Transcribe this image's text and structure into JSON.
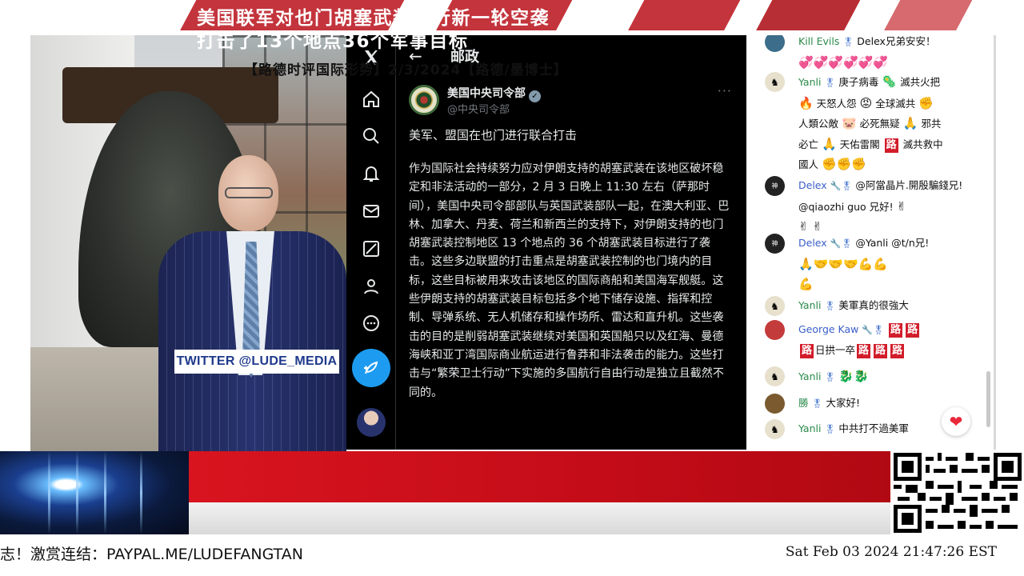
{
  "video": {
    "watermark": "TWITTER  @LUDE_MEDIA"
  },
  "x_post": {
    "header_title": "邮政",
    "author_name": "美国中央司令部",
    "author_handle": "@中央司令部",
    "headline": "美军、盟国在也门进行联合打击",
    "body": "作为国际社会持续努力应对伊朗支持的胡塞武装在该地区破坏稳定和非法活动的一部分，2 月 3 日晚上 11:30 左右（萨那时间），美国中央司令部部队与英国武装部队一起，在澳大利亚、巴林、加拿大、丹麦、荷兰和新西兰的支持下，对伊朗支持的也门胡塞武装控制地区 13 个地点的 36 个胡塞武装目标进行了袭击。这些多边联盟的打击重点是胡塞武装控制的也门境内的目标，这些目标被用来攻击该地区的国际商船和美国海军舰艇。这些伊朗支持的胡塞武装目标包括多个地下储存设施、指挥和控制、导弹系统、无人机储存和操作场所、雷达和直升机。这些袭击的目的是削弱胡塞武装继续对美国和英国船只以及红海、曼德海峡和亚丁湾国际商业航运进行鲁莽和非法袭击的能力。这些打击与“繁荣卫士行动”下实施的多国航行自由行动是独立且截然不同的。",
    "nav_icons": [
      "x-logo-icon",
      "home-icon",
      "search-icon",
      "bell-icon",
      "mail-icon",
      "grok-icon",
      "profile-icon",
      "more-icon",
      "post-icon"
    ]
  },
  "chat": {
    "messages": [
      {
        "author": "Kill Evils",
        "text": "Delex兄弟安安！"
      },
      {
        "author": "Yanli",
        "text1": "庚子病毒",
        "text2": "滅共火把",
        "text3": "天怒人怨",
        "text4": "全球滅共",
        "text5": "人類公敵",
        "text6": "必死無疑",
        "text7": "邪共",
        "text8": "必亡",
        "text9": "天佑雷閣",
        "road": "路",
        "text10": "滅共救中",
        "text11": "國人"
      },
      {
        "author": "Delex",
        "text": "@阿當晶片.開殷騙錢兄! @qiaozhi guo 兄好!"
      },
      {
        "author": "Delex",
        "text": "@Yanli @t/n兄!"
      },
      {
        "author": "Yanli",
        "text": "美軍真的很強大"
      },
      {
        "author": "George Kaw",
        "road": "路",
        "text": "日拱一卒"
      },
      {
        "author": "Yanli",
        "text": ""
      },
      {
        "author": "勝",
        "text": "大家好!"
      },
      {
        "author": "Yanli",
        "text": "中共打不過美軍"
      }
    ]
  },
  "banner": {
    "line1": "美国联军对也门胡塞武装进行新一轮空袭",
    "line2": "打击了13个地点36个军事目标",
    "subtitle": "【路德时评国际形势】2/3/2024【路德/墨博士】"
  },
  "ticker": "志！激赏连结：PAYPAL.ME/LUDEFANGTAN",
  "datetime": "Sat Feb 03 2024 21:47:26 EST",
  "colors": {
    "accent_red": "#d8141f",
    "x_blue": "#1d9bf0",
    "chat_author": "#3a5ec9"
  }
}
